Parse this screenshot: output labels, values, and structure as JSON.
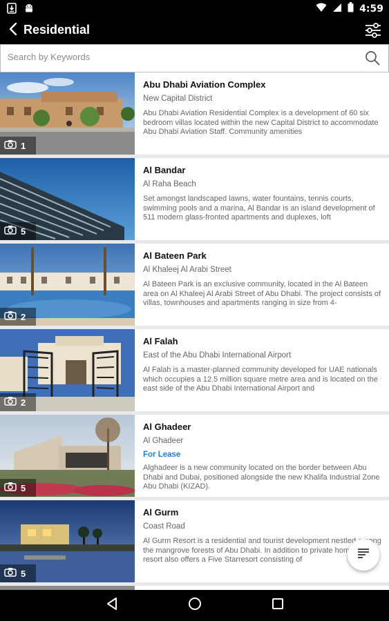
{
  "status_bar": {
    "time": "4:59",
    "left_icons": [
      "download-icon",
      "android-icon"
    ],
    "right_icons": [
      "wifi-icon",
      "signal-icon",
      "battery-icon"
    ]
  },
  "app_bar": {
    "title": "Residential",
    "back_icon": "chevron-left-icon",
    "filter_icon": "sliders-icon"
  },
  "search": {
    "placeholder": "Search by Keywords",
    "value": ""
  },
  "listings": [
    {
      "title": "Abu Dhabi Aviation Complex",
      "location": "New Capital District",
      "badge": "",
      "description": "Abu Dhabi Aviation Residential Complex is a development of 60 six bedroom villas located within the new Capital District to accommodate Abu Dhabi Aviation Staff. Community amenities",
      "photo_count": "1"
    },
    {
      "title": "Al Bandar",
      "location": "Al Raha Beach",
      "badge": "",
      "description": "Set amongst landscaped lawns, water fountains, tennis courts, swimming pools and a marina, Al Bandar is an island development of 511 modern glass-fronted apartments and duplexes, loft",
      "photo_count": "5"
    },
    {
      "title": "Al Bateen Park",
      "location": "Al Khaleej Al Arabi Street",
      "badge": "",
      "description": "Al Bateen Park is an exclusive community, located in the Al Bateen area on Al Khaleej Al Arabi Street of Abu Dhabi. The project consists of villas, townhouses and apartments ranging in size from 4-",
      "photo_count": "2"
    },
    {
      "title": "Al Falah",
      "location": "East of the Abu Dhabi International Airport",
      "badge": "",
      "description": "Al Falah is a master-planned community developed for UAE nationals which occupies a 12.5 million square metre area and is located on the east side of the Abu Dhabi International Airport and",
      "photo_count": "2"
    },
    {
      "title": "Al Ghadeer",
      "location": "Al Ghadeer",
      "badge": "For Lease",
      "description": "Alghadeer is a new community located on the border between Abu Dhabi and Dubai, positioned alongside the new Khalifa Industrial Zone Abu Dhabi (KIZAD).",
      "photo_count": "5"
    },
    {
      "title": "Al Gurm",
      "location": "Coast Road",
      "badge": "",
      "description": "Al Gurm Resort is a residential and tourist development nestled among the mangrove forests of Abu Dhabi. In addition to private homes, the resort also offers a Five Starresort consisting of",
      "photo_count": "5"
    }
  ],
  "fab": {
    "icon": "sort-lines-icon"
  },
  "nav_bar": {
    "icons": [
      "back-triangle-icon",
      "home-circle-icon",
      "recents-square-icon"
    ]
  }
}
